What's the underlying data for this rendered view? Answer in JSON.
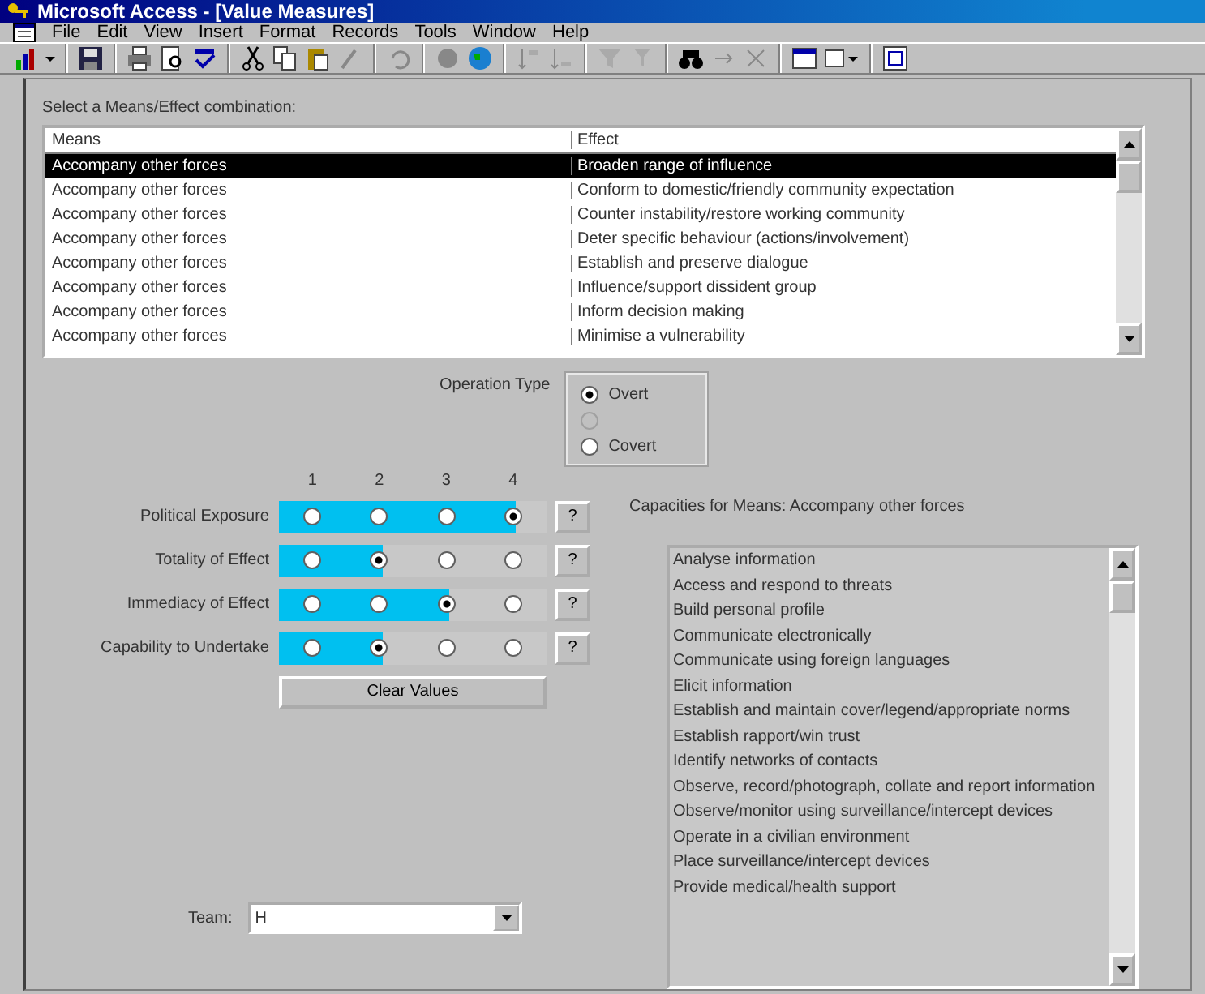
{
  "window": {
    "title": "Microsoft Access - [Value Measures]"
  },
  "menu": [
    "File",
    "Edit",
    "View",
    "Insert",
    "Format",
    "Records",
    "Tools",
    "Window",
    "Help"
  ],
  "combo_section": {
    "label": "Select a Means/Effect combination:",
    "columns": [
      "Means",
      "Effect"
    ],
    "rows": [
      {
        "means": "Accompany other forces",
        "effect": "Broaden range of influence",
        "selected": true
      },
      {
        "means": "Accompany other forces",
        "effect": "Conform to domestic/friendly community expectation",
        "selected": false
      },
      {
        "means": "Accompany other forces",
        "effect": "Counter instability/restore working community",
        "selected": false
      },
      {
        "means": "Accompany other forces",
        "effect": "Deter specific behaviour (actions/involvement)",
        "selected": false
      },
      {
        "means": "Accompany other forces",
        "effect": "Establish and preserve dialogue",
        "selected": false
      },
      {
        "means": "Accompany other forces",
        "effect": "Influence/support dissident group",
        "selected": false
      },
      {
        "means": "Accompany other forces",
        "effect": "Inform decision making",
        "selected": false
      },
      {
        "means": "Accompany other forces",
        "effect": "Minimise a vulnerability",
        "selected": false
      }
    ]
  },
  "operation_type": {
    "label": "Operation Type",
    "options": [
      {
        "label": "Overt",
        "selected": true,
        "disabled": false
      },
      {
        "selected": false,
        "disabled": true
      },
      {
        "label": "Covert",
        "selected": false,
        "disabled": false
      }
    ]
  },
  "ratings": {
    "scale": [
      "1",
      "2",
      "3",
      "4"
    ],
    "help_label": "?",
    "rows": [
      {
        "label": "Political Exposure",
        "choices": [
          {
            "selected": false
          },
          {
            "selected": false
          },
          {
            "selected": false
          },
          {
            "selected": true
          }
        ]
      },
      {
        "label": "Totality of Effect",
        "choices": [
          {
            "selected": false
          },
          {
            "selected": true
          },
          {
            "selected": false
          },
          {
            "selected": false
          }
        ]
      },
      {
        "label": "Immediacy of Effect",
        "choices": [
          {
            "selected": false
          },
          {
            "selected": false
          },
          {
            "selected": true
          },
          {
            "selected": false
          }
        ]
      },
      {
        "label": "Capability to Undertake",
        "choices": [
          {
            "selected": false
          },
          {
            "selected": true
          },
          {
            "selected": false
          },
          {
            "selected": false
          }
        ]
      }
    ],
    "clear_button": "Clear Values"
  },
  "team": {
    "label": "Team:",
    "value": "H"
  },
  "capacities": {
    "label": "Capacities for Means: Accompany other forces",
    "items": [
      "Analyse information",
      "Access and respond to threats",
      "Build personal profile",
      "Communicate electronically",
      "Communicate using foreign languages",
      "Elicit information",
      "Establish and maintain cover/legend/appropriate norms",
      "Establish rapport/win trust",
      "Identify networks of contacts",
      "Observe, record/photograph, collate and report information",
      "Observe/monitor using surveillance/intercept devices",
      "Operate in a civilian environment",
      "Place surveillance/intercept devices",
      "Provide medical/health support"
    ]
  }
}
